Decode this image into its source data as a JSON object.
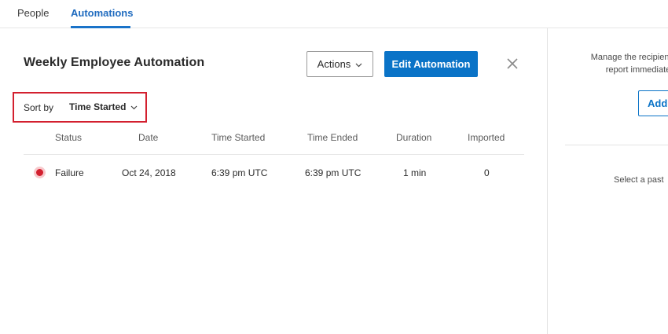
{
  "tabs": {
    "people": "People",
    "automations": "Automations"
  },
  "header": {
    "title": "Weekly Employee Automation",
    "actions_label": "Actions",
    "edit_label": "Edit Automation"
  },
  "sort": {
    "label": "Sort by",
    "value": "Time Started"
  },
  "table": {
    "headers": [
      "Status",
      "Date",
      "Time Started",
      "Time Ended",
      "Duration",
      "Imported"
    ],
    "rows": [
      {
        "status": "Failure",
        "date": "Oct 24, 2018",
        "time_started": "6:39 pm UTC",
        "time_ended": "6:39 pm UTC",
        "duration": "1 min",
        "imported": "0",
        "status_color": "#d3202f"
      }
    ]
  },
  "side_panel": {
    "text_line1": "Manage the recipients th",
    "text_line2": "report immediate",
    "add_label": "Add",
    "select_text": "Select a past"
  },
  "colors": {
    "accent": "#0a73c7",
    "failure": "#d3202f",
    "highlight_box": "#d3202f"
  }
}
